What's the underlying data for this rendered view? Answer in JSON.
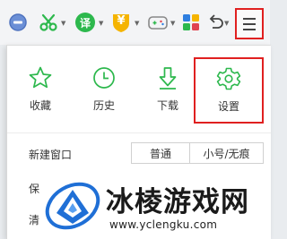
{
  "toolbar": {
    "items": [
      {
        "icon": "compat-mode-icon"
      },
      {
        "icon": "screenshot-scissors-icon"
      },
      {
        "icon": "translate-icon",
        "label": "译"
      },
      {
        "icon": "coupon-icon",
        "label": "¥"
      },
      {
        "icon": "game-controller-icon"
      },
      {
        "icon": "apps-grid-icon"
      },
      {
        "icon": "undo-icon"
      },
      {
        "icon": "menu-icon"
      }
    ],
    "colors": {
      "green": "#2db84d",
      "gold": "#f5b400",
      "blue": "#2f7fe0",
      "red": "#e02020"
    }
  },
  "menu": {
    "quick_actions": [
      {
        "label": "收藏",
        "icon": "star-icon"
      },
      {
        "label": "历史",
        "icon": "clock-icon"
      },
      {
        "label": "下载",
        "icon": "download-icon"
      },
      {
        "label": "设置",
        "icon": "gear-icon",
        "highlighted": true
      }
    ],
    "new_window": {
      "label": "新建窗口",
      "options": [
        "普通",
        "小号/无痕"
      ]
    },
    "row2_label": "保",
    "row3_label": "清"
  },
  "watermark": {
    "title": "冰棱游戏网",
    "url": "www.yclengku.com"
  },
  "accent_color": "#2db84d"
}
